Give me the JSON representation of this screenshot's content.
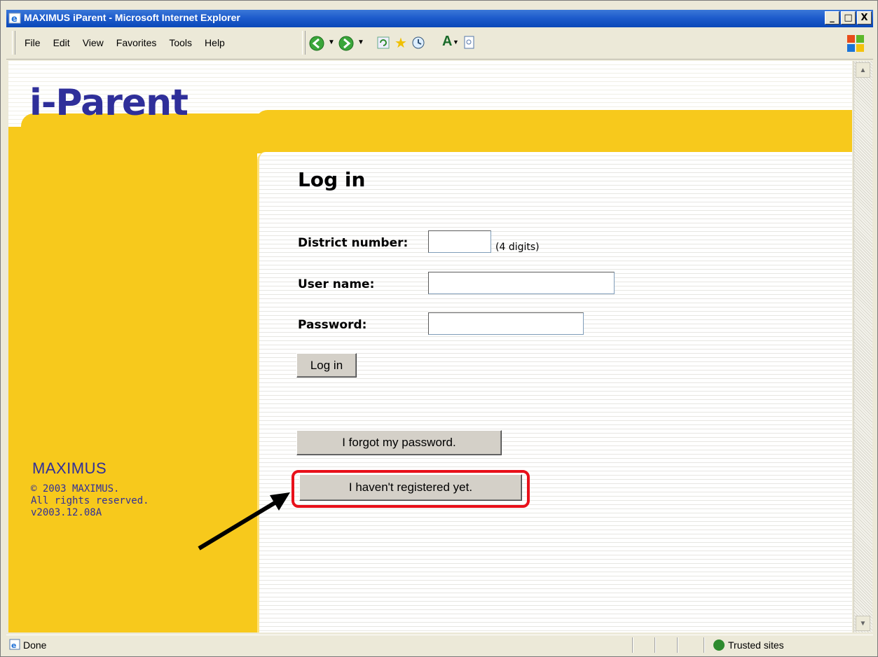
{
  "window": {
    "title": "MAXIMUS iParent - Microsoft Internet Explorer",
    "minimize_glyph": "_",
    "maximize_glyph": "□",
    "close_glyph": "X"
  },
  "menu": {
    "items": [
      "File",
      "Edit",
      "View",
      "Favorites",
      "Tools",
      "Help"
    ]
  },
  "toolbar": {
    "icons": [
      "back-icon",
      "forward-icon",
      "refresh-icon",
      "favorites-star-icon",
      "history-icon",
      "font-size-icon",
      "page-icon"
    ]
  },
  "page": {
    "logo": "i-Parent",
    "heading": "Log in",
    "district_label": "District number:",
    "district_value": "",
    "district_hint": "(4 digits)",
    "username_label": "User name:",
    "username_value": "",
    "password_label": "Password:",
    "password_value": "",
    "login_button": "Log in",
    "forgot_button": "I forgot my password.",
    "register_button": "I haven't registered yet."
  },
  "footer": {
    "brand": "MAXIMUS",
    "copyright": "© 2003 MAXIMUS.",
    "rights": "All rights reserved.",
    "version": "v2003.12.08A"
  },
  "status": {
    "text": "Done",
    "zone": "Trusted sites"
  },
  "colors": {
    "accent_yellow": "#f7c91c",
    "brand_blue": "#2f2f9a",
    "highlight_red": "#e8101a"
  }
}
